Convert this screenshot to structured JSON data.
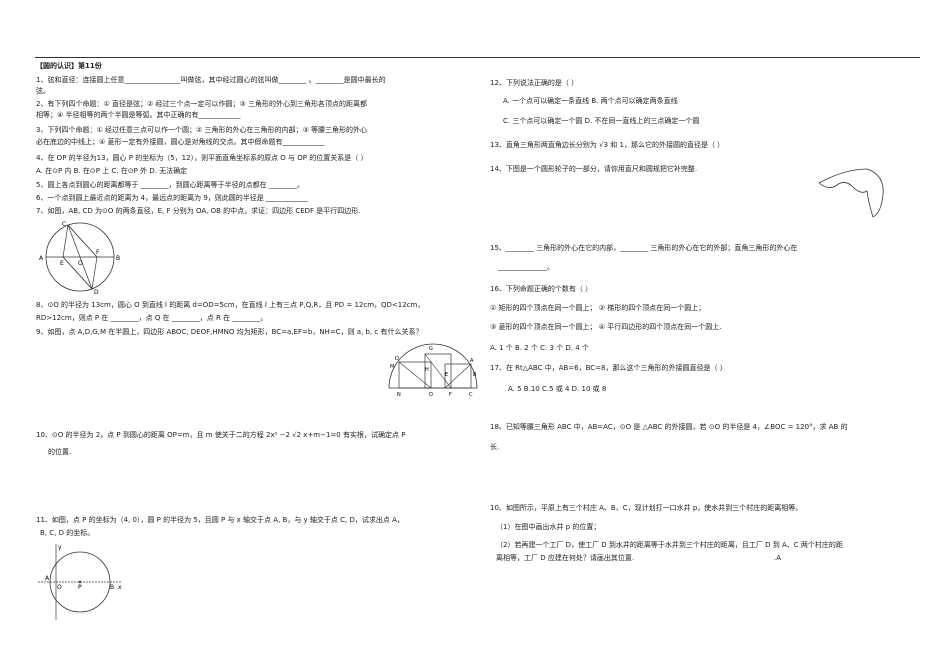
{
  "left": {
    "header": "【圆的认识】第11份",
    "lines": [
      {
        "id": "q1a",
        "text": "1、弦和直径：连接圆上任意________________叫做弦，其中经过圆心的弦叫做________ 。________是圆中最长的"
      },
      {
        "id": "q1b",
        "text": "弦。"
      },
      {
        "id": "q2a",
        "text": "2、有下列四个命题：① 直径是弦；② 经过三个点一定可以作圆；③ 三角形的外心到三角形各顶点的距离都"
      },
      {
        "id": "q2b",
        "text": "相等；④ 半径相等的两个半圆是等弧。其中正确的有____________"
      },
      {
        "id": "q3a",
        "text": "3、下列四个命题：① 经过任意三点可以作一个圆；② 三角形的外心在三角形的内部；③ 等腰三角形的外心"
      },
      {
        "id": "q3b",
        "text": "必在底边的中线上；④ 菱形一定有外接圆，圆心是对角线的交点。其中假命题有____________"
      },
      {
        "id": "q4a",
        "text": "4、在 OP 的半径为13，圆心 P 的坐标为（5，12），则平面直角坐标系的原点 O 与 OP 的位置关系是（ ）"
      },
      {
        "id": "q4b",
        "text": "A. 在⊙P 内          B. 在⊙P 上          C. 在⊙P 外          D. 无法确定"
      },
      {
        "id": "q5",
        "text": "5、圆上各点到圆心的距离都等于 ________，到圆心距离等于半径的点都在 ________。"
      },
      {
        "id": "q6",
        "text": "6、一个点到圆上最近点的距离为 4，最远点的距离为 9，则此圆的半径是 ____________"
      },
      {
        "id": "q7",
        "text": "7、如图，AB, CD 为⊙O 的两条直径，E, F 分别为 OA, OB 的中点，求证：四边形 CEDF 是平行四边形."
      },
      {
        "id": "q8a",
        "text": "8、⊙O 的半径为 13cm，圆心 O 到直线 l 的距离 d=OD=5cm，在直线 l 上有三点 P,Q,R，且 PD = 12cm，QD<12cm，"
      },
      {
        "id": "q8b",
        "text": "RD>12cm，则点 P 在 ________，点 Q 在 ________，点 R 在 ________。"
      },
      {
        "id": "q9",
        "text": "9、如图，点 A,D,G,M 在半圆上，四边形 ABOC, DEOF,HMNO 均为矩形，BC=a,EF=b，NH=C，则 a, b, c 有什么关系？"
      },
      {
        "id": "q10a",
        "text": "10、⊙O 的半径为 2，点 P 到圆心的距离 OP=m，且 m 使关于二的方程 2x² −2 √2 x+m−1=0 有实根，试确定点 P"
      },
      {
        "id": "q10b",
        "text": "的位置."
      },
      {
        "id": "q11a",
        "text": "11、如图，点 P 的坐标为（4, 0），圆 P 的半径为 5，且圆 P 与 x 轴交于点 A, B，与 y 轴交于点 C, D，试求出点 A，"
      },
      {
        "id": "q11b",
        "text": "B, C, D 的坐标。"
      }
    ],
    "fig7_labels": [
      "C",
      "A",
      "E",
      "O",
      "F",
      "B",
      "D"
    ],
    "fig9_labels": [
      "D",
      "M",
      "G",
      "A",
      "H",
      "E",
      "B",
      "N",
      "O",
      "F",
      "C"
    ],
    "fig11_labels": [
      "y",
      "A",
      "O",
      "P",
      "B",
      "x"
    ]
  },
  "right": {
    "lines": [
      {
        "id": "r12",
        "text": "12、下列说法正确的是（        ）"
      },
      {
        "id": "r12ab",
        "text": "A. 一个点可以确定一条直线          B. 两个点可以确定两条直线"
      },
      {
        "id": "r12cd",
        "text": "C. 三个点可以确定一个圆            D. 不在同一直线上的三点确定一个圆"
      },
      {
        "id": "r13",
        "text": "13、直角三角形两直角边长分别为 √3 和 1，那么它的外接圆的直径是（        ）"
      },
      {
        "id": "r14",
        "text": "14、下图是一个圆形轮子的一部分，请你用直尺和圆规把它补完整."
      },
      {
        "id": "r15a",
        "text": "15、________ 三角形的外心在它的内部，________ 三角形的外心在它的外部；直角三角形的外心在"
      },
      {
        "id": "r15b",
        "text": "______________。"
      },
      {
        "id": "r16",
        "text": "16、下列命题正确的个数有（        ）"
      },
      {
        "id": "r16a",
        "text": "① 矩形的四个顶点在同一个圆上；    ② 梯形的四个顶点在同一个圆上；"
      },
      {
        "id": "r16b",
        "text": "③ 菱形的四个顶点在同一个圆上；    ④ 平行四边形的四个顶点在同一个圆上."
      },
      {
        "id": "r16c",
        "text": "A. 1 个               B. 2 个               C. 3 个               D. 4 个"
      },
      {
        "id": "r17",
        "text": "17、在 Rt△ABC 中，AB=6，BC=8，那么这个三角形的外接圆直径是（        ）"
      },
      {
        "id": "r17o",
        "text": "A. 5               B.10               C.5 或 4               D. 10 或 8"
      },
      {
        "id": "r18a",
        "text": "18、已知等腰三角形 ABC 中，AB=AC，⊙O 是 △ABC 的外接圆，若 ⊙O 的半径是 4，∠BOC = 120°，求 AB 的"
      },
      {
        "id": "r18b",
        "text": "长."
      },
      {
        "id": "r10a",
        "text": "10、如图所示，平原上有三个村庄 A、B、C，现计划打一口水井 p，使水井到三个村庄的距离相等。"
      },
      {
        "id": "r10b",
        "text": "（1）在图中画出水井 p 的位置；"
      },
      {
        "id": "r10c",
        "text": "（2）若再建一个工厂 D，使工厂 D 到水井的距离等于水井到三个村庄的距离，且工厂 D 到 A、C 两个村庄的距"
      },
      {
        "id": "r10d",
        "text": "离相等，工厂 D 应建在何处？请画出其位置."
      }
    ],
    "point_label": ".A"
  }
}
